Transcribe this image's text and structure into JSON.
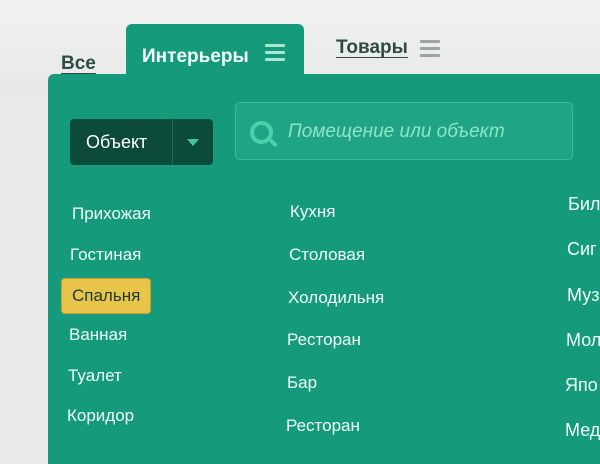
{
  "tabs": {
    "all_label": "Все",
    "interiors_label": "Интерьеры",
    "goods_label": "Товары"
  },
  "filter": {
    "object_select": "Объект",
    "search_placeholder": "Помещение или объект"
  },
  "rooms": {
    "col1": [
      "Прихожая",
      "Гостиная",
      "Спальня",
      "Ванная",
      "Туалет",
      "Коридор"
    ],
    "col2": [
      "Кухня",
      "Столовая",
      "Холодильня",
      "Ресторан",
      "Бар",
      "Ресторан"
    ],
    "col3": [
      "Бил",
      "Сиг",
      "Муз",
      "Мол",
      "Япо",
      "Мед"
    ],
    "selected": "Спальня"
  },
  "colors": {
    "panel": "#169a7c",
    "select_bg": "#0c4a3c",
    "selected_item": "#e9c44a"
  }
}
